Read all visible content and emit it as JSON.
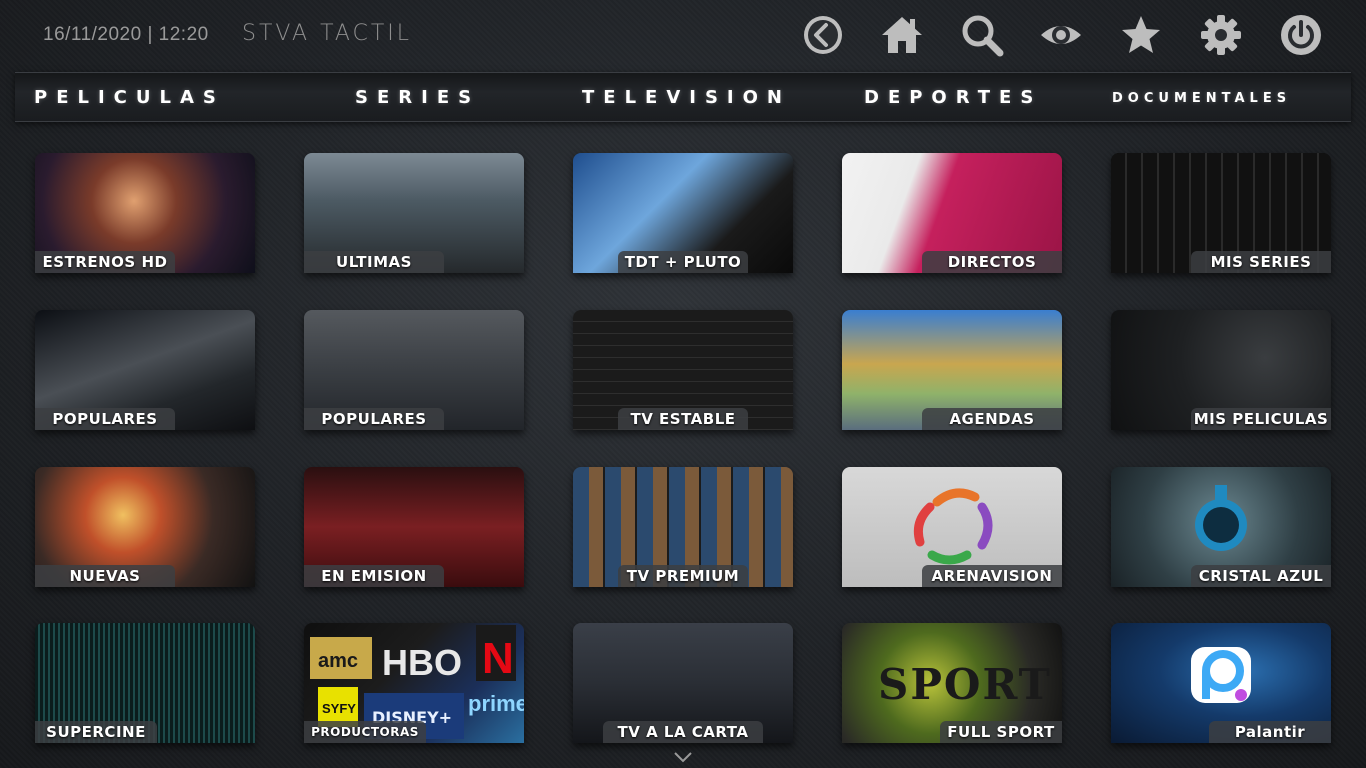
{
  "header": {
    "datetime": "16/11/2020 | 12:20",
    "title": "STVA TACTIL",
    "icons": [
      "back-icon",
      "home-icon",
      "search-icon",
      "eye-icon",
      "star-icon",
      "gear-icon",
      "power-icon"
    ]
  },
  "nav": {
    "items": [
      "PELICULAS",
      "SERIES",
      "TELEVISION",
      "DEPORTES",
      "DOCUMENTALES"
    ]
  },
  "tiles": [
    {
      "label": "ESTRENOS HD"
    },
    {
      "label": "ULTIMAS"
    },
    {
      "label": "TDT + PLUTO"
    },
    {
      "label": "DIRECTOS"
    },
    {
      "label": "MIS SERIES"
    },
    {
      "label": "POPULARES"
    },
    {
      "label": "POPULARES"
    },
    {
      "label": "TV ESTABLE"
    },
    {
      "label": "AGENDAS"
    },
    {
      "label": "MIS PELICULAS"
    },
    {
      "label": "NUEVAS"
    },
    {
      "label": "EN EMISION"
    },
    {
      "label": "TV PREMIUM"
    },
    {
      "label": "ARENAVISION"
    },
    {
      "label": "CRISTAL AZUL"
    },
    {
      "label": "SUPERCINE"
    },
    {
      "label": "PRODUCTORAS"
    },
    {
      "label": "TV A LA CARTA"
    },
    {
      "label": "FULL SPORT"
    },
    {
      "label": "Palantir"
    }
  ],
  "tile_text": {
    "productoras_logos": [
      "amc",
      "HBO",
      "N",
      "SYFY",
      "DISNEY+",
      "prime"
    ],
    "full_sport_text": "SPORT"
  },
  "colors": {
    "icon": "#bdbdbd",
    "label_bg": "#3c3e42",
    "palantir_accent": "#3da9f5"
  }
}
